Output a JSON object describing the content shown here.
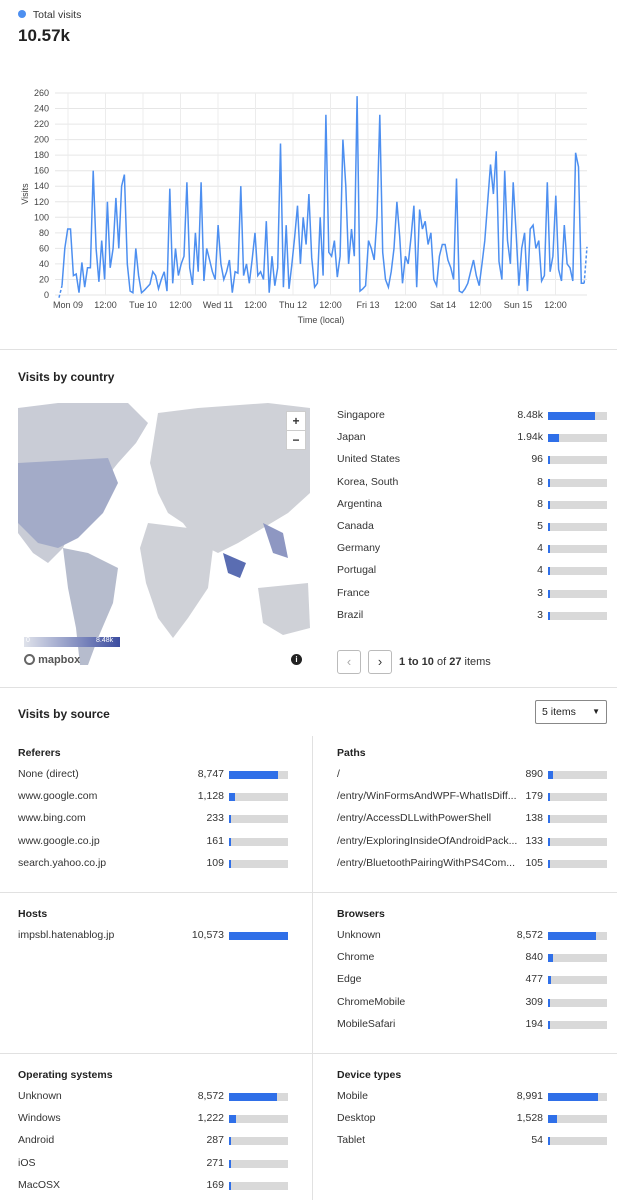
{
  "visits_chart": {
    "legend": "Total visits",
    "total": "10.57k",
    "ylabel": "Visits",
    "xlabel": "Time (local)",
    "y_ticks": [
      "0",
      "20",
      "40",
      "60",
      "80",
      "100",
      "120",
      "140",
      "160",
      "180",
      "200",
      "220",
      "240",
      "260"
    ],
    "x_ticks": [
      "Mon 09",
      "12:00",
      "Tue 10",
      "12:00",
      "Wed 11",
      "12:00",
      "Thu 12",
      "12:00",
      "Fri 13",
      "12:00",
      "Sat 14",
      "12:00",
      "Sun 15",
      "12:00"
    ],
    "line_color": "#4d8ff0"
  },
  "chart_data": {
    "type": "line",
    "title": "",
    "xlabel": "Time (local)",
    "ylabel": "Visits",
    "ylim": [
      0,
      260
    ],
    "x_start": "Mon 09 00:00",
    "x_step_hours": 2,
    "series": [
      {
        "name": "Total visits",
        "values": [
          12,
          60,
          85,
          85,
          25,
          27,
          3,
          42,
          10,
          35,
          35,
          160,
          60,
          17,
          70,
          20,
          120,
          35,
          60,
          125,
          60,
          140,
          155,
          40,
          5,
          3,
          60,
          25,
          3,
          6,
          10,
          14,
          30,
          25,
          8,
          20,
          30,
          5,
          137,
          15,
          60,
          25,
          40,
          50,
          145,
          35,
          13,
          80,
          30,
          145,
          18,
          60,
          45,
          30,
          20,
          90,
          40,
          20,
          30,
          45,
          3,
          30,
          28,
          140,
          25,
          40,
          15,
          45,
          80,
          25,
          30,
          20,
          95,
          3,
          50,
          12,
          35,
          195,
          10,
          90,
          8,
          40,
          75,
          115,
          40,
          100,
          65,
          130,
          48,
          10,
          15,
          100,
          25,
          232,
          55,
          50,
          70,
          23,
          50,
          200,
          140,
          40,
          85,
          50,
          256,
          5,
          8,
          12,
          70,
          60,
          45,
          100,
          232,
          55,
          20,
          10,
          30,
          60,
          120,
          75,
          15,
          50,
          40,
          75,
          115,
          10,
          110,
          85,
          95,
          65,
          80,
          20,
          12,
          50,
          65,
          65,
          45,
          35,
          20,
          150,
          5,
          3,
          8,
          15,
          30,
          45,
          25,
          12,
          40,
          70,
          120,
          168,
          130,
          185,
          43,
          20,
          160,
          70,
          40,
          145,
          80,
          12,
          60,
          80,
          5,
          85,
          90,
          60,
          70,
          18,
          25,
          145,
          30,
          50,
          128,
          33,
          18,
          90,
          40,
          35,
          18,
          183,
          165,
          15,
          15,
          62
        ]
      }
    ]
  },
  "country_section": {
    "title": "Visits by country",
    "zoom_in": "+",
    "zoom_out": "−",
    "scale_min": "0",
    "scale_max": "8.48k",
    "attribution": "mapbox",
    "info": "i",
    "countries": [
      {
        "name": "Singapore",
        "value": "8.48k",
        "fraction": 0.8
      },
      {
        "name": "Japan",
        "value": "1.94k",
        "fraction": 0.18
      },
      {
        "name": "United States",
        "value": "96",
        "fraction": 0.01
      },
      {
        "name": "Korea, South",
        "value": "8",
        "fraction": 0.004
      },
      {
        "name": "Argentina",
        "value": "8",
        "fraction": 0.004
      },
      {
        "name": "Canada",
        "value": "5",
        "fraction": 0.003
      },
      {
        "name": "Germany",
        "value": "4",
        "fraction": 0.003
      },
      {
        "name": "Portugal",
        "value": "4",
        "fraction": 0.003
      },
      {
        "name": "France",
        "value": "3",
        "fraction": 0.002
      },
      {
        "name": "Brazil",
        "value": "3",
        "fraction": 0.002
      }
    ],
    "pagination": {
      "prev": "‹",
      "next": "›",
      "range_start": "1",
      "to": "to",
      "range_end": "10",
      "of": "of",
      "total": "27",
      "items": "items"
    }
  },
  "source_section": {
    "title": "Visits by source",
    "items_select": "5 items",
    "referers": {
      "title": "Referers",
      "rows": [
        {
          "label": "None (direct)",
          "value": "8,747",
          "fraction": 0.83
        },
        {
          "label": "www.google.com",
          "value": "1,128",
          "fraction": 0.11
        },
        {
          "label": "www.bing.com",
          "value": "233",
          "fraction": 0.022
        },
        {
          "label": "www.google.co.jp",
          "value": "161",
          "fraction": 0.015
        },
        {
          "label": "search.yahoo.co.jp",
          "value": "109",
          "fraction": 0.01
        }
      ]
    },
    "paths": {
      "title": "Paths",
      "rows": [
        {
          "label": "/",
          "value": "890",
          "fraction": 0.084
        },
        {
          "label": "/entry/WinFormsAndWPF-WhatIsDiff...",
          "value": "179",
          "fraction": 0.017
        },
        {
          "label": "/entry/AccessDLLwithPowerShell",
          "value": "138",
          "fraction": 0.013
        },
        {
          "label": "/entry/ExploringInsideOfAndroidPack...",
          "value": "133",
          "fraction": 0.013
        },
        {
          "label": "/entry/BluetoothPairingWithPS4Com...",
          "value": "105",
          "fraction": 0.01
        }
      ]
    },
    "hosts": {
      "title": "Hosts",
      "rows": [
        {
          "label": "impsbl.hatenablog.jp",
          "value": "10,573",
          "fraction": 1.0
        }
      ]
    },
    "browsers": {
      "title": "Browsers",
      "rows": [
        {
          "label": "Unknown",
          "value": "8,572",
          "fraction": 0.81
        },
        {
          "label": "Chrome",
          "value": "840",
          "fraction": 0.08
        },
        {
          "label": "Edge",
          "value": "477",
          "fraction": 0.045
        },
        {
          "label": "ChromeMobile",
          "value": "309",
          "fraction": 0.03
        },
        {
          "label": "MobileSafari",
          "value": "194",
          "fraction": 0.018
        }
      ]
    },
    "operating_systems": {
      "title": "Operating systems",
      "rows": [
        {
          "label": "Unknown",
          "value": "8,572",
          "fraction": 0.81
        },
        {
          "label": "Windows",
          "value": "1,222",
          "fraction": 0.115
        },
        {
          "label": "Android",
          "value": "287",
          "fraction": 0.027
        },
        {
          "label": "iOS",
          "value": "271",
          "fraction": 0.026
        },
        {
          "label": "MacOSX",
          "value": "169",
          "fraction": 0.016
        }
      ]
    },
    "device_types": {
      "title": "Device types",
      "rows": [
        {
          "label": "Mobile",
          "value": "8,991",
          "fraction": 0.85
        },
        {
          "label": "Desktop",
          "value": "1,528",
          "fraction": 0.145
        },
        {
          "label": "Tablet",
          "value": "54",
          "fraction": 0.005
        }
      ]
    }
  }
}
